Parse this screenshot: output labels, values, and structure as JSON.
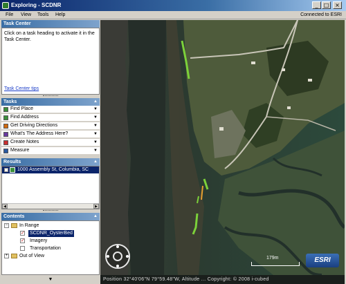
{
  "window": {
    "title": "Exploring - SCDNR",
    "minimize": "_",
    "maximize": "□",
    "close": "×"
  },
  "menu": [
    "File",
    "View",
    "Tools",
    "Help"
  ],
  "connection_status": "Connected to ESRI",
  "task_center": {
    "header": "Task Center",
    "message": "Click on a task heading to activate it in the Task Center.",
    "tips_link": "Task Center tips"
  },
  "tasks": {
    "header": "Tasks",
    "items": [
      {
        "label": "Find Place",
        "icon": "find-place-icon",
        "color": "#3a8f3a"
      },
      {
        "label": "Find Address",
        "icon": "find-address-icon",
        "color": "#3a8f3a"
      },
      {
        "label": "Get Driving Directions",
        "icon": "directions-icon",
        "color": "#d06a10"
      },
      {
        "label": "What's The Address Here?",
        "icon": "address-here-icon",
        "color": "#6a3aa0"
      },
      {
        "label": "Create Notes",
        "icon": "notes-icon",
        "color": "#c83030"
      },
      {
        "label": "Measure",
        "icon": "measure-icon",
        "color": "#2a5aa0"
      }
    ]
  },
  "results": {
    "header": "Results",
    "items": [
      {
        "label": "1000 Assembly St, Columbia, SC"
      }
    ]
  },
  "contents": {
    "header": "Contents",
    "tree": [
      {
        "label": "In Range",
        "level": 0,
        "expander": "−"
      },
      {
        "label": "SCDNR_OysterBed",
        "level": 1,
        "checked": true,
        "selected": true
      },
      {
        "label": "Imagery",
        "level": 1,
        "checked": true,
        "selected": false
      },
      {
        "label": "Transportation",
        "level": 1,
        "checked": false,
        "selected": false
      },
      {
        "label": "Out of View",
        "level": 0,
        "expander": "+"
      }
    ]
  },
  "map": {
    "status_text": "Position 32°40'06\"N  79°59.48\"W, Altitude ...  Copyright: © 2008 i-cubed",
    "scale_label": "179m",
    "logo": "ESRI"
  },
  "colors": {
    "header_blue": "#3a6ea5",
    "oyster_green": "#7cd13a",
    "water_dark": "#28352d",
    "marsh": "#4d5a3c"
  }
}
